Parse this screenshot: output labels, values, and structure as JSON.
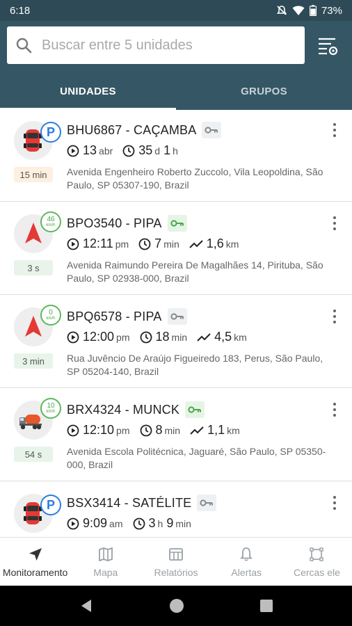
{
  "status_bar": {
    "time": "6:18",
    "battery": "73%"
  },
  "search": {
    "placeholder": "Buscar entre 5 unidades"
  },
  "tabs": [
    {
      "label": "UNIDADES",
      "active": true
    },
    {
      "label": "GRUPOS",
      "active": false
    }
  ],
  "units": [
    {
      "name": "BHU6867 - CAÇAMBA",
      "icon": "red-car-icon",
      "status": "parked",
      "age": "15 min",
      "key_on": false,
      "stats": [
        {
          "icon": "play-circle-icon",
          "value": "13",
          "unit": "abr"
        },
        {
          "icon": "clock-icon",
          "value": "35",
          "unit": "d",
          "value2": "1",
          "unit2": "h"
        }
      ],
      "address": "Avenida Engenheiro Roberto Zuccolo, Vila Leopoldina, São Paulo, SP 05307-190, Brazil"
    },
    {
      "name": "BPO3540 - PIPA",
      "icon": "red-arrow-icon",
      "status": "moving",
      "speed": "46",
      "speed_unit": "km/h",
      "age": "3 s",
      "key_on": true,
      "stats": [
        {
          "icon": "play-circle-icon",
          "value": "12:11",
          "unit": "pm"
        },
        {
          "icon": "clock-icon",
          "value": "7",
          "unit": "min"
        },
        {
          "icon": "trend-icon",
          "value": "1,6",
          "unit": "km"
        }
      ],
      "address": "Avenida Raimundo Pereira De Magalhães 14, Pirituba, São Paulo, SP 02938-000, Brazil"
    },
    {
      "name": "BPQ6578 - PIPA",
      "icon": "red-arrow-icon",
      "status": "stopped",
      "speed": "0",
      "speed_unit": "km/h",
      "age": "3 min",
      "key_on": false,
      "stats": [
        {
          "icon": "play-circle-icon",
          "value": "12:00",
          "unit": "pm"
        },
        {
          "icon": "clock-icon",
          "value": "18",
          "unit": "min"
        },
        {
          "icon": "trend-icon",
          "value": "4,5",
          "unit": "km"
        }
      ],
      "address": "Rua Juvêncio De Araújo Figueiredo 183, Perus, São Paulo, SP 05204-140, Brazil"
    },
    {
      "name": "BRX4324 - MUNCK",
      "icon": "tanker-truck-icon",
      "status": "moving",
      "speed": "10",
      "speed_unit": "km/h",
      "age": "54 s",
      "key_on": true,
      "stats": [
        {
          "icon": "play-circle-icon",
          "value": "12:10",
          "unit": "pm"
        },
        {
          "icon": "clock-icon",
          "value": "8",
          "unit": "min"
        },
        {
          "icon": "trend-icon",
          "value": "1,1",
          "unit": "km"
        }
      ],
      "address": "Avenida Escola Politécnica, Jaguaré, São Paulo, SP 05350-000, Brazil"
    },
    {
      "name": "BSX3414 - SATÉLITE",
      "icon": "red-car-icon",
      "status": "parked",
      "age": "",
      "key_on": false,
      "stats": [
        {
          "icon": "play-circle-icon",
          "value": "9:09",
          "unit": "am"
        },
        {
          "icon": "clock-icon",
          "value": "3",
          "unit": "h",
          "value2": "9",
          "unit2": "min"
        }
      ],
      "address": ""
    }
  ],
  "parking_badge": "P",
  "bottom_nav": [
    {
      "label": "Monitoramento",
      "icon": "navigation-arrow-icon",
      "active": true
    },
    {
      "label": "Mapa",
      "icon": "map-icon",
      "active": false
    },
    {
      "label": "Relatórios",
      "icon": "report-icon",
      "active": false
    },
    {
      "label": "Alertas",
      "icon": "bell-icon",
      "active": false
    },
    {
      "label": "Cercas ele",
      "icon": "fence-icon",
      "active": false
    }
  ],
  "colors": {
    "header": "#355664",
    "statusbar": "#2d4a56",
    "green": "#4aa84a",
    "blue": "#2a7de1",
    "red": "#e53935"
  }
}
